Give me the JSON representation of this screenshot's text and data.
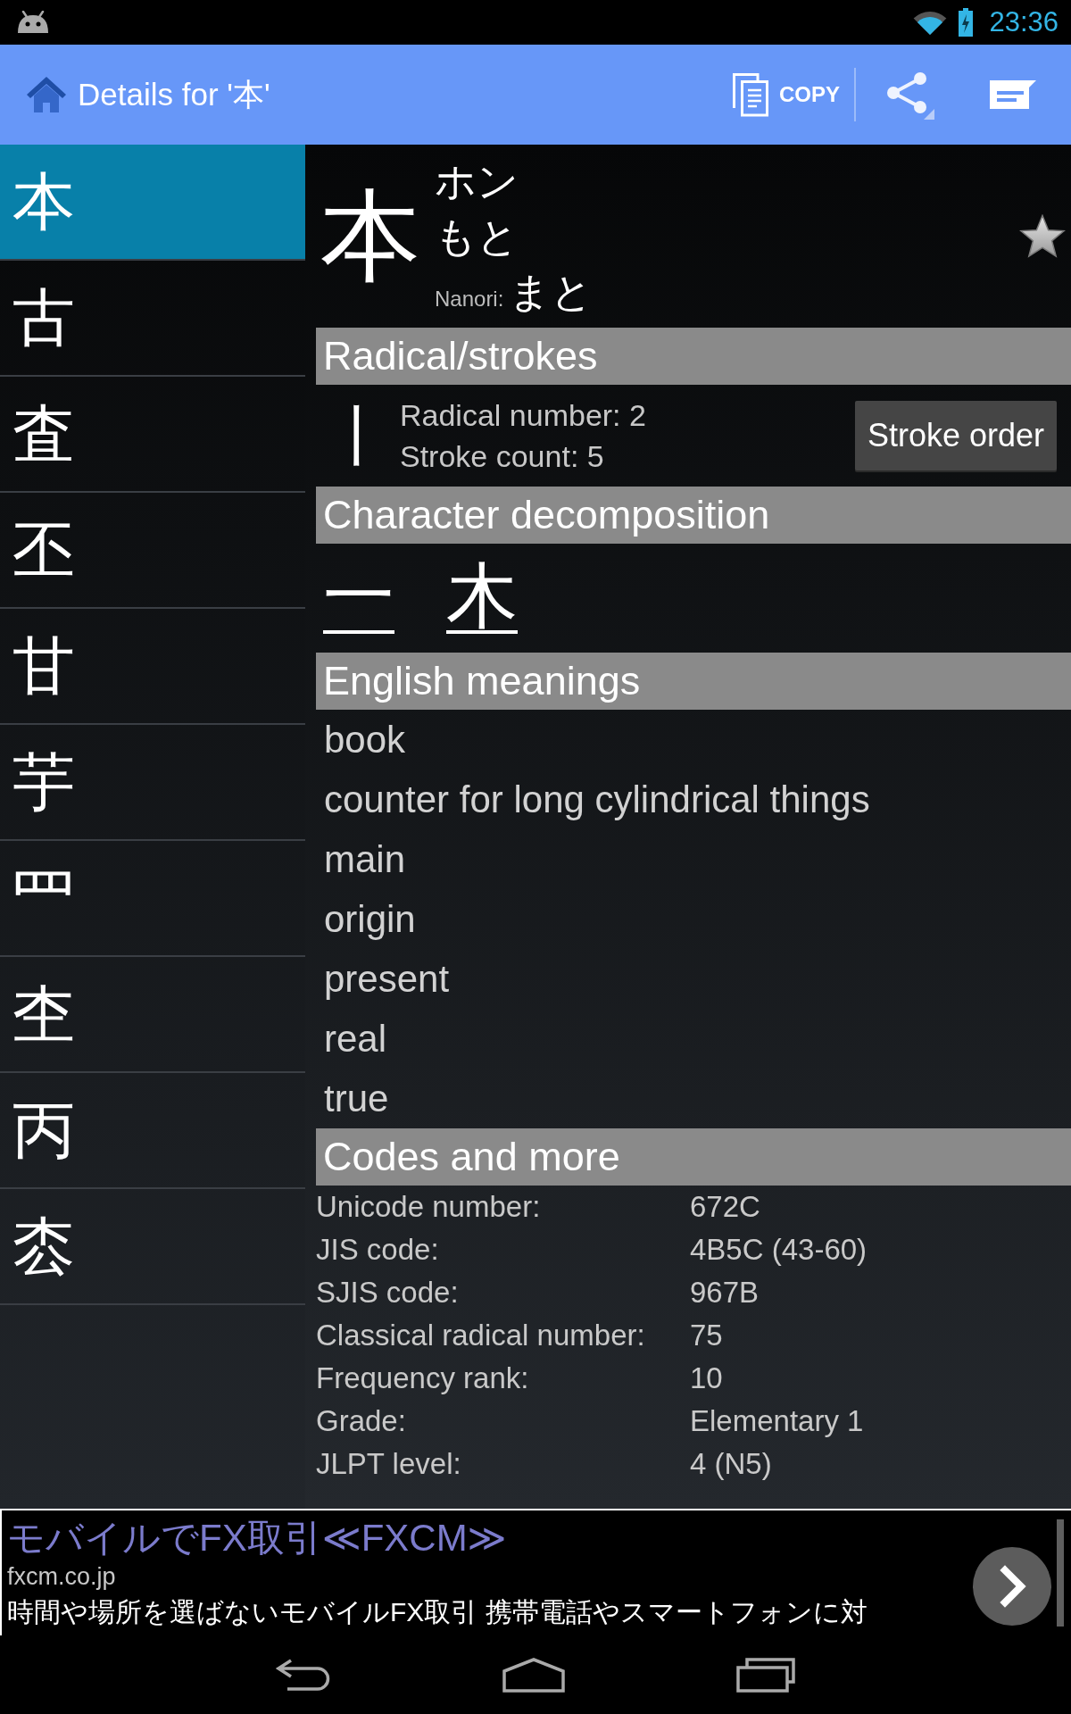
{
  "status_bar": {
    "time": "23:36"
  },
  "action_bar": {
    "title": "Details for '本'",
    "copy_label": "COPY"
  },
  "kanji_list": [
    {
      "kanji": "本",
      "selected": true
    },
    {
      "kanji": "古",
      "selected": false
    },
    {
      "kanji": "査",
      "selected": false
    },
    {
      "kanji": "丕",
      "selected": false
    },
    {
      "kanji": "甘",
      "selected": false
    },
    {
      "kanji": "芋",
      "selected": false
    },
    {
      "kanji": "罒",
      "selected": false
    },
    {
      "kanji": "杢",
      "selected": false
    },
    {
      "kanji": "丙",
      "selected": false
    },
    {
      "kanji": "枩",
      "selected": false
    }
  ],
  "kanji": {
    "character": "本",
    "readings": [
      "ホン",
      "もと"
    ],
    "nanori_label": "Nanori:",
    "nanori": "まと",
    "starred": false
  },
  "radical_strokes": {
    "heading": "Radical/strokes",
    "radical": "丨",
    "radical_number": "Radical number: 2",
    "stroke_count": "Stroke count: 5",
    "button": "Stroke order"
  },
  "decomposition": {
    "heading": "Character decomposition",
    "parts": [
      "一",
      "木"
    ]
  },
  "meanings": {
    "heading": "English meanings",
    "items": [
      "book",
      "counter for long cylindrical things",
      "main",
      "origin",
      "present",
      "real",
      "true"
    ]
  },
  "codes": {
    "heading": "Codes and more",
    "rows": [
      {
        "label": "Unicode number:",
        "value": "672C"
      },
      {
        "label": "JIS code:",
        "value": "4B5C (43-60)"
      },
      {
        "label": "SJIS code:",
        "value": "967B"
      },
      {
        "label": "Classical radical number:",
        "value": "75"
      },
      {
        "label": "Frequency rank:",
        "value": "10"
      },
      {
        "label": "Grade:",
        "value": "Elementary 1"
      },
      {
        "label": "JLPT level:",
        "value": "4 (N5)"
      }
    ]
  },
  "ad": {
    "title": "モバイルでFX取引≪FXCM≫",
    "domain": "fxcm.co.jp",
    "text": "時間や場所を選ばないモバイルFX取引 携帯電話やスマートフォンに対"
  }
}
